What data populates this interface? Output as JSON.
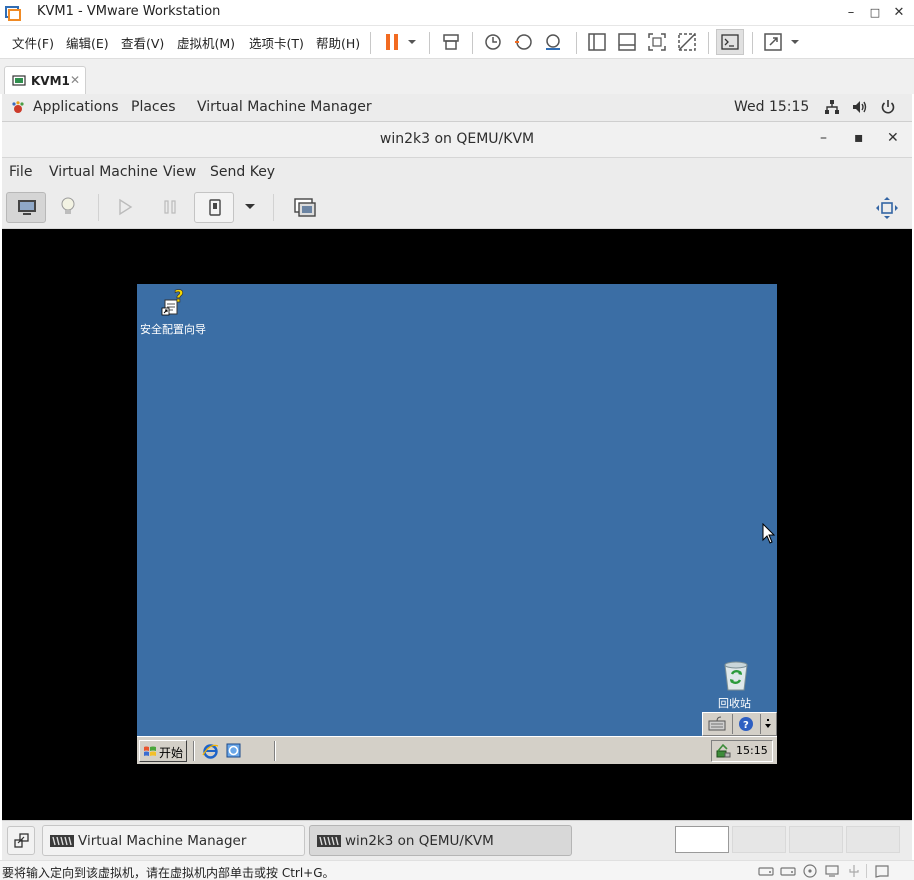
{
  "vmware": {
    "title": "KVM1 - VMware Workstation",
    "window_controls": {
      "minimize": "–",
      "maximize": "□",
      "close": "✕"
    },
    "menus": [
      "文件(F)",
      "编辑(E)",
      "查看(V)",
      "虚拟机(M)",
      "选项卡(T)",
      "帮助(H)"
    ],
    "tab": {
      "label": "KVM1",
      "close": "✕"
    },
    "accent": "#f26b21"
  },
  "gnome": {
    "applications": "Applications",
    "places": "Places",
    "vmm": "Virtual Machine Manager",
    "clock": "Wed 15:15"
  },
  "viewer": {
    "title": "win2k3 on QEMU/KVM",
    "controls": {
      "minimize": "–",
      "maximize": "▪",
      "close": "✕"
    },
    "menus": [
      "File",
      "Virtual Machine",
      "View",
      "Send Key"
    ]
  },
  "guest": {
    "desktop_color": "#3b6ea5",
    "icons": {
      "security_wizard": "安全配置向导",
      "recycle_bin": "回收站"
    },
    "taskbar": {
      "start": "开始",
      "clock": "15:15"
    }
  },
  "panel": {
    "tasks": [
      "Virtual Machine Manager",
      "win2k3 on QEMU/KVM"
    ]
  },
  "status": {
    "hint": "要将输入定向到该虚拟机，请在虚拟机内部单击或按 Ctrl+G。"
  }
}
